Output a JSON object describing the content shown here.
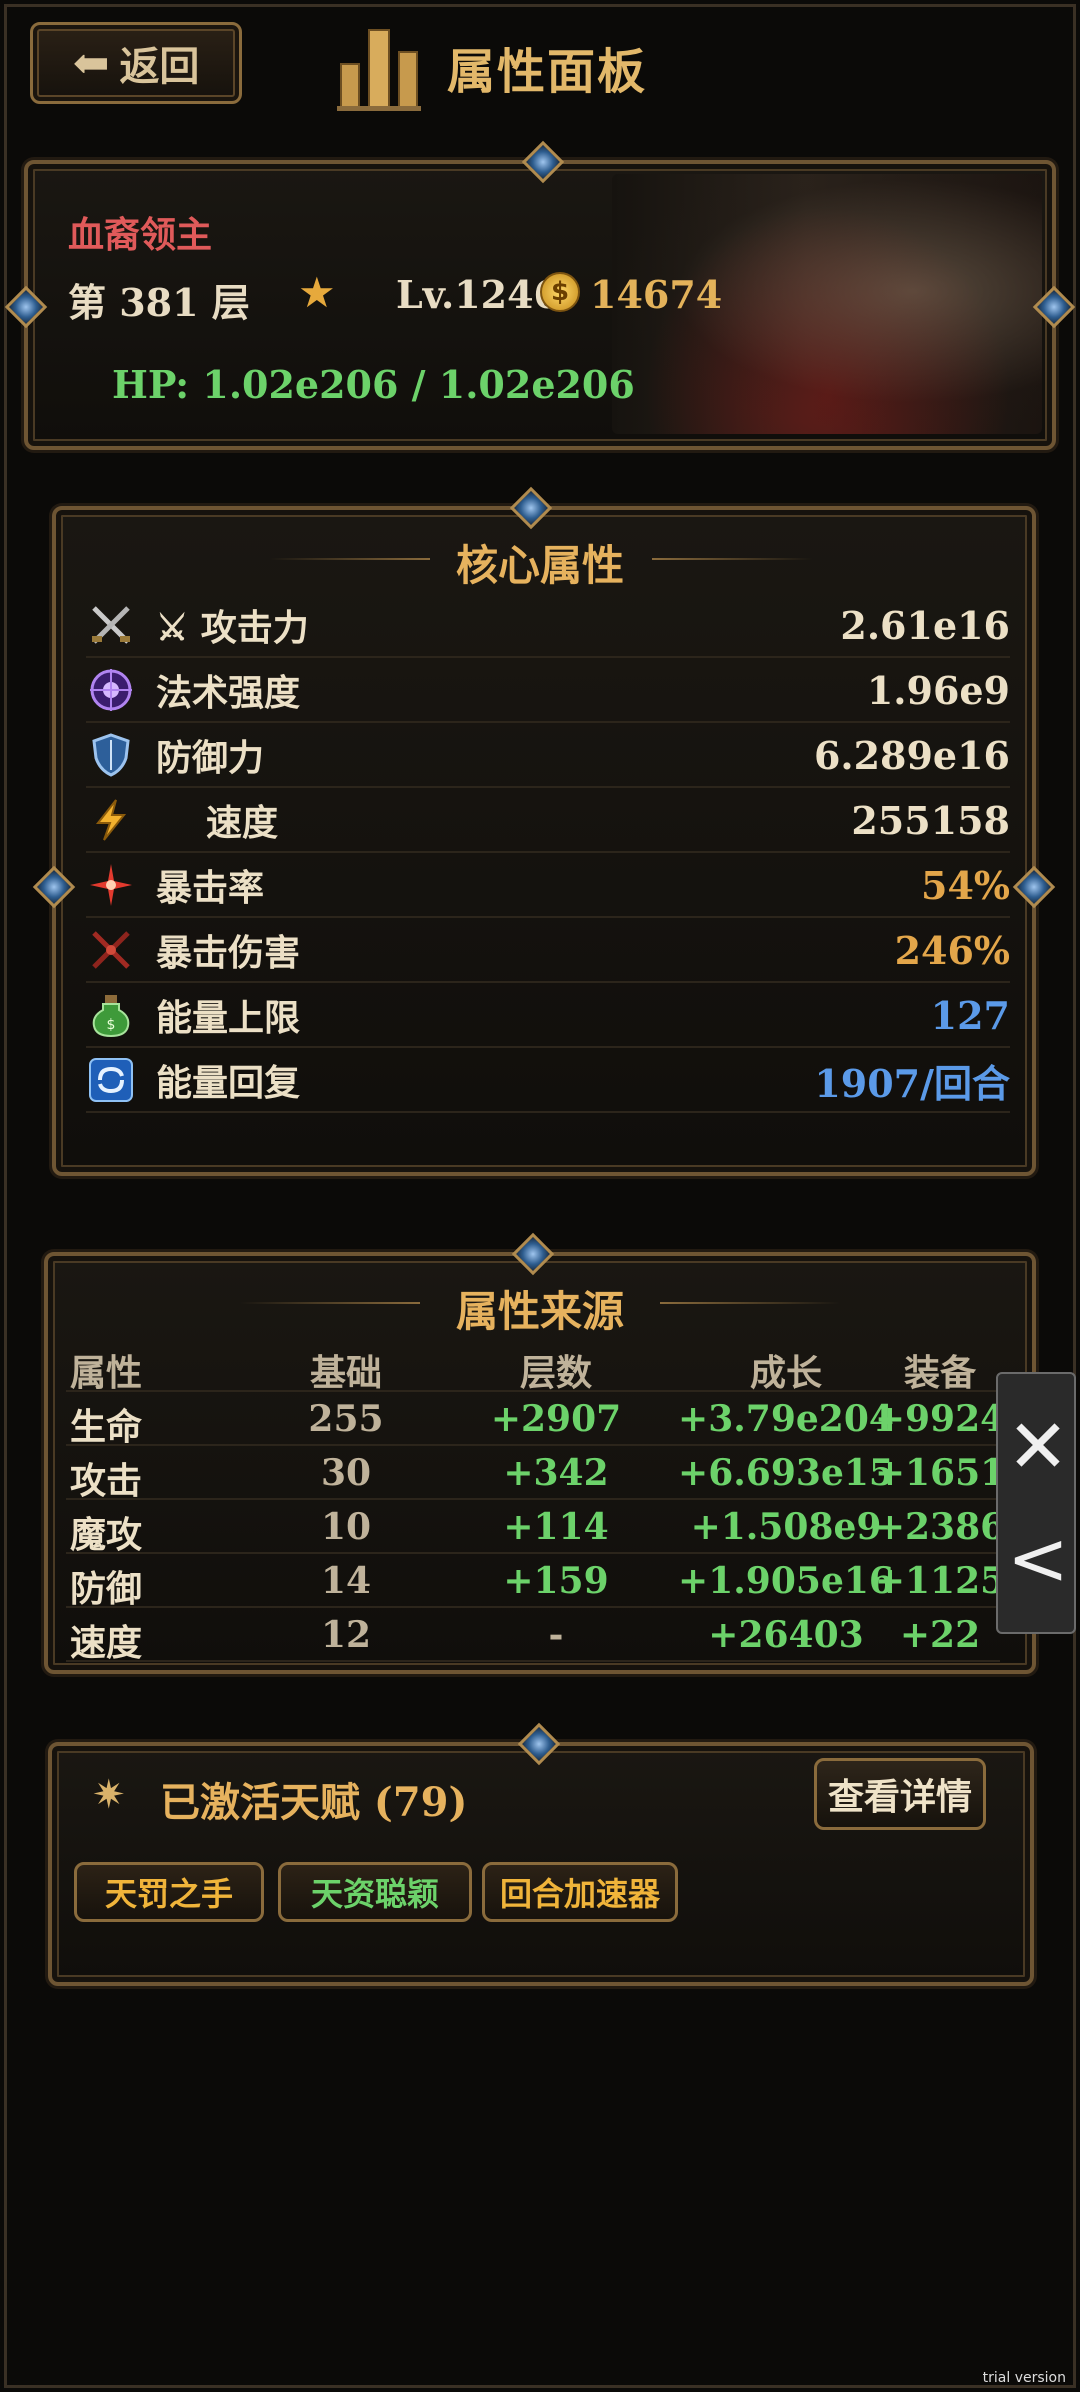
{
  "header": {
    "back_label": "返回",
    "title": "属性面板"
  },
  "boss": {
    "name": "血裔领主",
    "floor": "第 381 层",
    "level": "Lv.1246",
    "gold": "14674",
    "hp": "HP: 1.02e206 / 1.02e206"
  },
  "core": {
    "title": "核心属性",
    "stats": [
      {
        "icon": "crossed-swords-icon",
        "label": "⚔ 攻击力",
        "value": "2.61e16",
        "color": "#ece0c6"
      },
      {
        "icon": "magic-orb-icon",
        "label": "法术强度",
        "value": "1.96e9",
        "color": "#ece0c6"
      },
      {
        "icon": "shield-icon",
        "label": "防御力",
        "value": "6.289e16",
        "color": "#ece0c6"
      },
      {
        "icon": "lightning-icon",
        "label": "速度",
        "value": "255158",
        "color": "#ece0c6"
      },
      {
        "icon": "crit-burst-icon",
        "label": "暴击率",
        "value": "54%",
        "color": "#e3a64a"
      },
      {
        "icon": "crit-damage-icon",
        "label": "暴击伤害",
        "value": "246%",
        "color": "#e3a64a"
      },
      {
        "icon": "potion-icon",
        "label": "能量上限",
        "value": "127",
        "color": "#5b9ae8"
      },
      {
        "icon": "regen-swirl-icon",
        "label": "能量回复",
        "value": "1907/回合",
        "color": "#5b9ae8"
      }
    ]
  },
  "sources": {
    "title": "属性来源",
    "headers": [
      "属性",
      "基础",
      "层数",
      "成长",
      "装备"
    ],
    "rows": [
      [
        "生命",
        "255",
        "+2907",
        "+3.79e204",
        "+9924"
      ],
      [
        "攻击",
        "30",
        "+342",
        "+6.693e15",
        "+1651"
      ],
      [
        "魔攻",
        "10",
        "+114",
        "+1.508e9",
        "+2386"
      ],
      [
        "防御",
        "14",
        "+159",
        "+1.905e16",
        "+1125"
      ],
      [
        "速度",
        "12",
        "-",
        "+26403",
        "+22"
      ]
    ]
  },
  "talents": {
    "title": "已激活天赋 (79)",
    "detail_label": "查看详情",
    "tags": [
      {
        "label": "天罚之手",
        "color": "#f0b43a"
      },
      {
        "label": "天资聪颖",
        "color": "#6cd26a"
      },
      {
        "label": "回合加速器",
        "color": "#f0b43a"
      }
    ]
  },
  "float": {
    "close_glyph": "✕",
    "collapse_glyph": "<"
  },
  "watermark": "trial version"
}
